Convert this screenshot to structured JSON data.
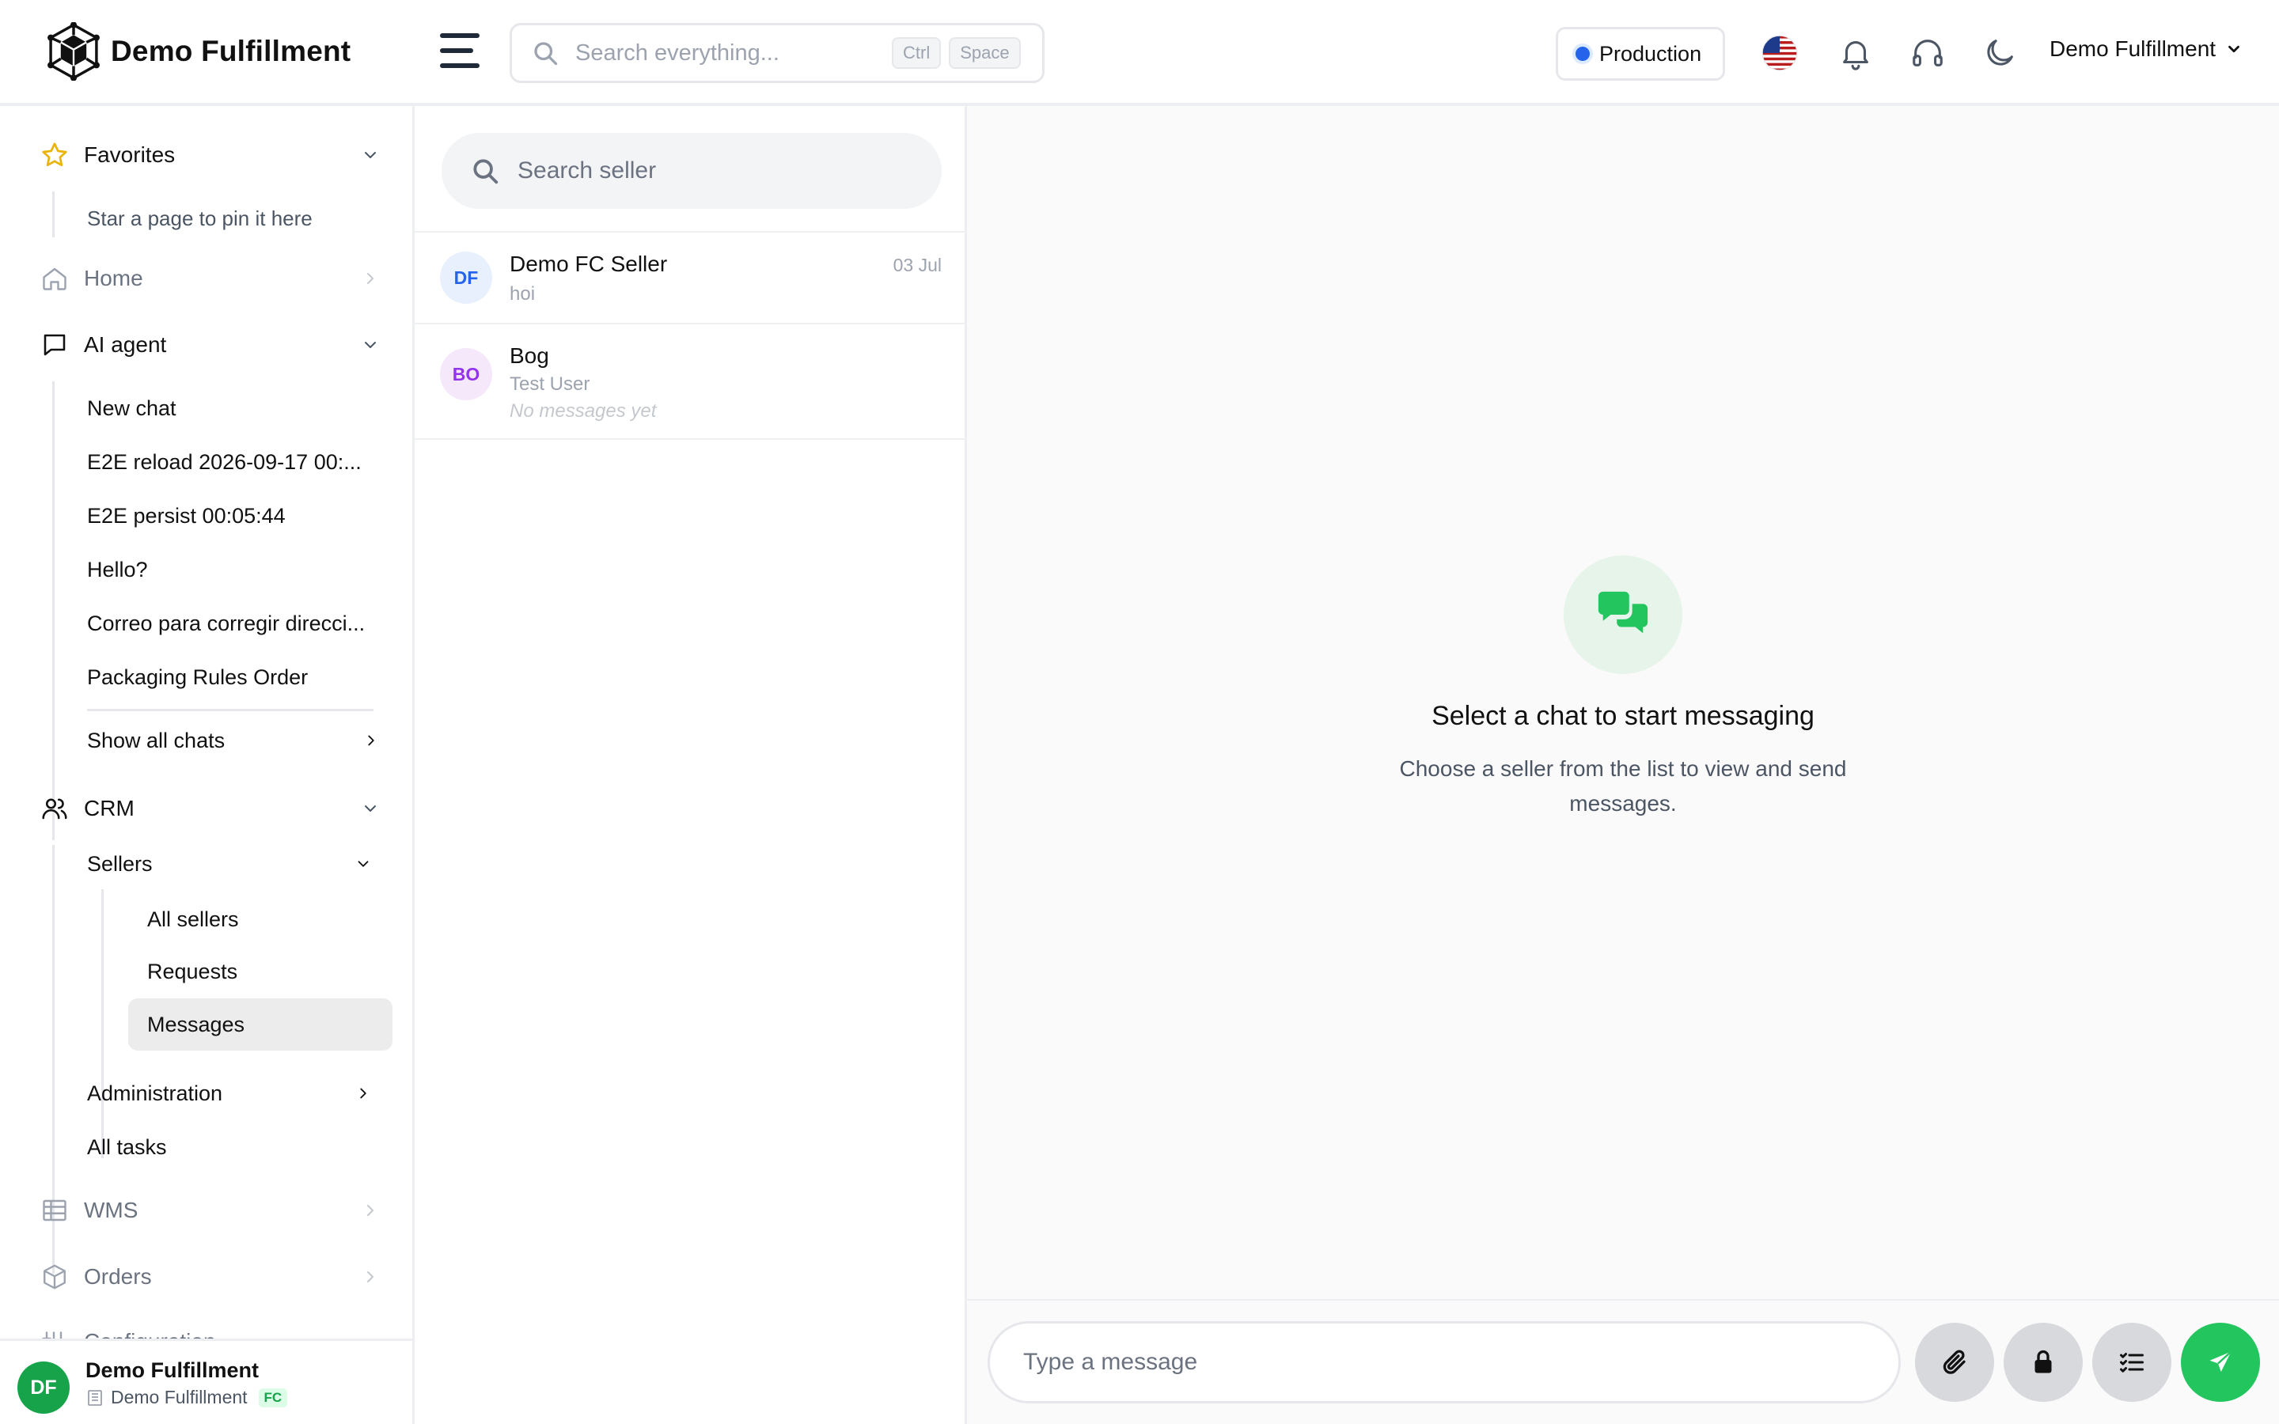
{
  "header": {
    "brand": "Demo Fulfillment",
    "search_placeholder": "Search everything...",
    "shortcut_keys": [
      "Ctrl",
      "Space"
    ],
    "environment": "Production",
    "user_menu": "Demo Fulfillment"
  },
  "sidebar": {
    "favorites": {
      "label": "Favorites",
      "hint": "Star a page to pin it here"
    },
    "home": "Home",
    "ai_agent": {
      "label": "AI agent",
      "items": [
        "New chat",
        "E2E reload 2026-09-17 00:...",
        "E2E persist 00:05:44",
        "Hello?",
        "Correo para corregir direcci...",
        "Packaging Rules Order"
      ],
      "show_all": "Show all chats"
    },
    "crm": {
      "label": "CRM",
      "sellers": {
        "label": "Sellers",
        "items": [
          "All sellers",
          "Requests",
          "Messages"
        ]
      },
      "administration": "Administration",
      "all_tasks": "All tasks"
    },
    "wms": "WMS",
    "orders": "Orders",
    "configuration": "Configuration",
    "footer": {
      "initials": "DF",
      "name": "Demo Fulfillment",
      "org": "Demo Fulfillment",
      "badge": "FC"
    }
  },
  "seller_list": {
    "search_placeholder": "Search seller",
    "sellers": [
      {
        "initials": "DF",
        "name": "Demo FC Seller",
        "preview": "hoi",
        "date": "03 Jul"
      },
      {
        "initials": "BO",
        "name": "Bog",
        "subtitle": "Test User",
        "preview": "No messages yet"
      }
    ]
  },
  "chat": {
    "empty_title": "Select a chat to start messaging",
    "empty_description": "Choose a seller from the list to view and send messages.",
    "input_placeholder": "Type a message"
  },
  "colors": {
    "accent_green": "#22c55e",
    "env_dot": "#2563eb",
    "favorite_star": "#eab308",
    "active_item_bg": "#ececec"
  }
}
